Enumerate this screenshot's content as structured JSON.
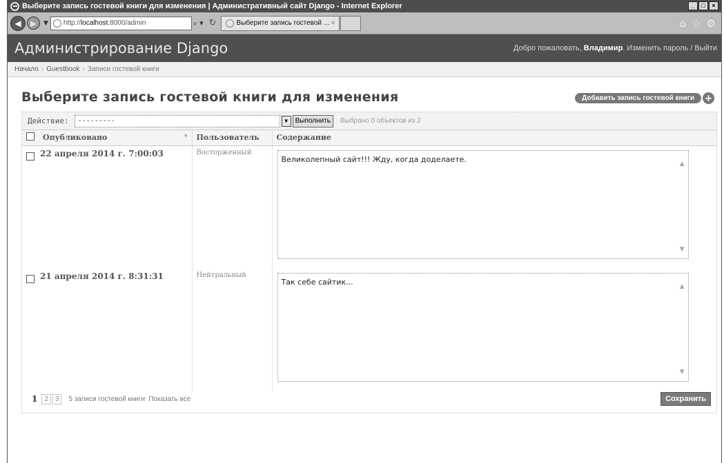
{
  "browser": {
    "window_title": "Выберите запись гостевой книги для изменения | Административный сайт Django - Internet Explorer",
    "address_prefix": "http://",
    "address_host": "localhost",
    "address_rest": ":8000/admin",
    "tab_title": "Выберите запись гостевой ...",
    "minimize": "_",
    "maximize": "□",
    "close": "×"
  },
  "header": {
    "brand": "Администрирование Django",
    "welcome": "Добро пожаловать,",
    "username": "Владимир",
    "change_password": "Изменить пароль",
    "logout": "Выйти"
  },
  "breadcrumb": {
    "home": "Начало",
    "app": "Guestbook",
    "current": "Записи гостевой книги"
  },
  "page": {
    "title": "Выберите запись гостевой книги для изменения",
    "add_button": "Добавить запись гостевой книги"
  },
  "actions": {
    "label": "Действие:",
    "selected_value": "---------",
    "run_button": "Выполнить",
    "counter": "Выбрано 0 объектов из 2"
  },
  "table": {
    "columns": [
      "Опубликовано",
      "Пользователь",
      "Содержание"
    ],
    "rows": [
      {
        "date": "22 апреля 2014 г. 7:00:03",
        "user": "Восторженный",
        "content": "Великолепный сайт!!! Жду, когда доделаете."
      },
      {
        "date": "21 апреля 2014 г. 8:31:31",
        "user": "Нейтральный",
        "content": "Так себе сайтик..."
      }
    ]
  },
  "paginator": {
    "current_page": "1",
    "pages": [
      "2",
      "3"
    ],
    "count_text": "5 записи гостевой книги",
    "show_all": "Показать все",
    "save_button": "Сохранить"
  }
}
